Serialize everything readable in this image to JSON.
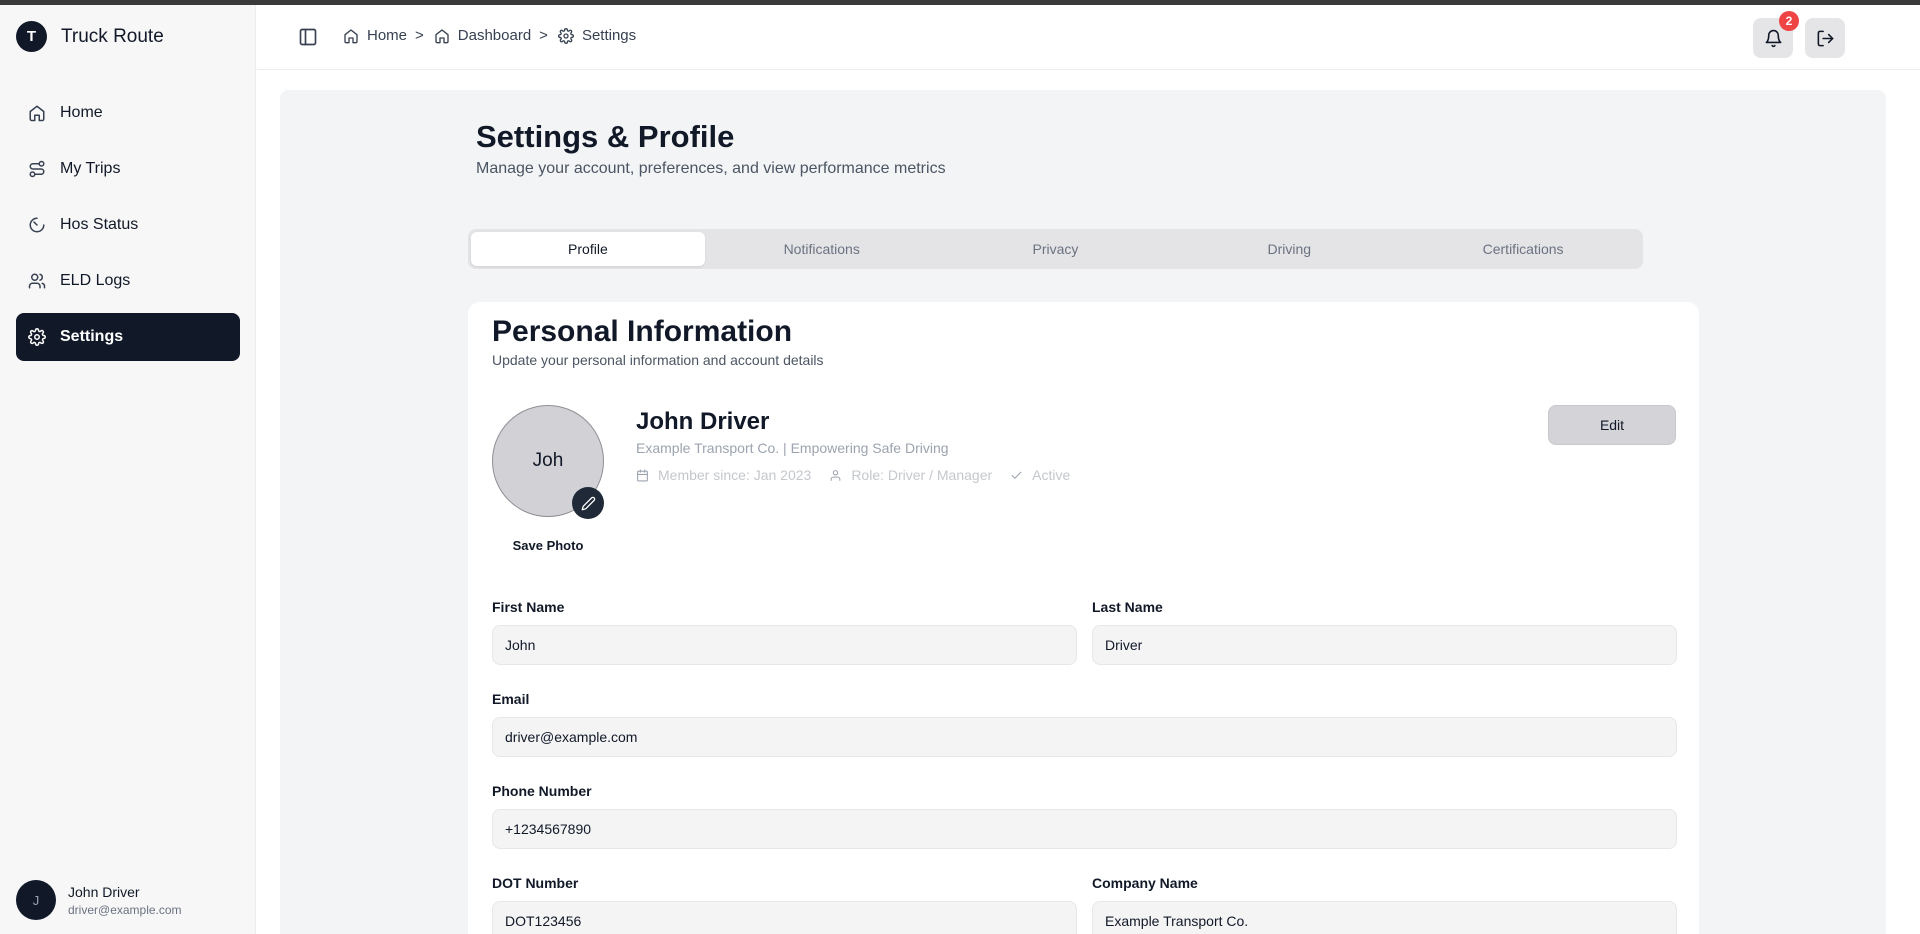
{
  "app": {
    "logo_letter": "T",
    "name": "Truck Route"
  },
  "sidebar": {
    "items": [
      {
        "label": "Home",
        "icon": "home-icon"
      },
      {
        "label": "My Trips",
        "icon": "route-icon"
      },
      {
        "label": "Hos Status",
        "icon": "gauge-icon"
      },
      {
        "label": "ELD Logs",
        "icon": "users-icon"
      },
      {
        "label": "Settings",
        "icon": "gear-icon",
        "active": true
      }
    ],
    "user": {
      "initial": "J",
      "name": "John Driver",
      "email": "driver@example.com"
    }
  },
  "header": {
    "breadcrumb": [
      {
        "label": "Home",
        "icon": "home-icon"
      },
      {
        "label": "Dashboard",
        "icon": "home-icon"
      },
      {
        "label": "Settings",
        "icon": "gear-icon"
      }
    ],
    "separator": ">",
    "notification_count": "2"
  },
  "page": {
    "title": "Settings & Profile",
    "subtitle": "Manage your account, preferences, and view performance metrics"
  },
  "tabs": [
    {
      "label": "Profile",
      "active": true
    },
    {
      "label": "Notifications"
    },
    {
      "label": "Privacy"
    },
    {
      "label": "Driving"
    },
    {
      "label": "Certifications"
    }
  ],
  "personal": {
    "title": "Personal Information",
    "subtitle": "Update your personal information and account details",
    "avatar_text": "Joh",
    "save_photo": "Save Photo",
    "name": "John Driver",
    "company_line": "Example Transport Co. | Empowering Safe Driving",
    "member_since": "Member since: Jan 2023",
    "role": "Role: Driver / Manager",
    "status": "Active",
    "edit_label": "Edit"
  },
  "form": {
    "first_name": {
      "label": "First Name",
      "value": "John"
    },
    "last_name": {
      "label": "Last Name",
      "value": "Driver"
    },
    "email": {
      "label": "Email",
      "value": "driver@example.com"
    },
    "phone": {
      "label": "Phone Number",
      "value": "+1234567890"
    },
    "dot": {
      "label": "DOT Number",
      "value": "DOT123456"
    },
    "company": {
      "label": "Company Name",
      "value": "Example Transport Co."
    }
  },
  "colors": {
    "primary": "#111827",
    "badge": "#ef4444",
    "background": "#f3f4f6"
  }
}
